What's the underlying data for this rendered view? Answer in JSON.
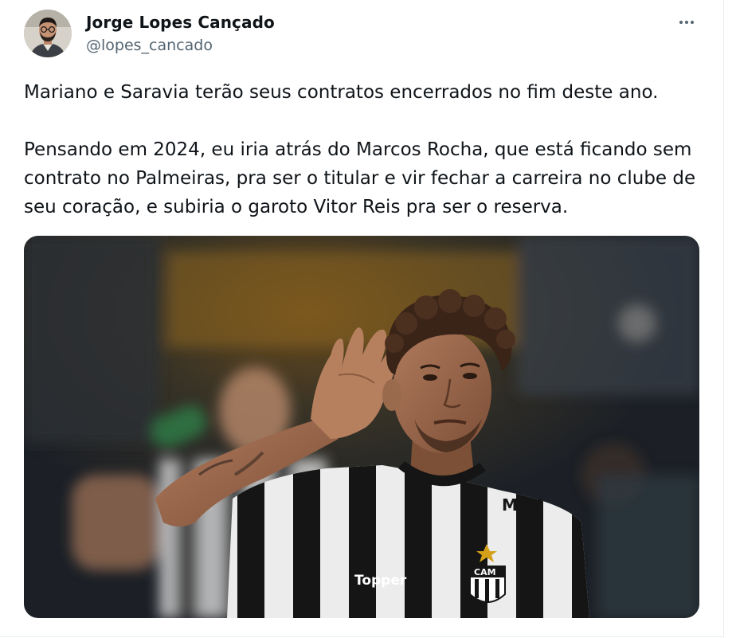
{
  "tweet": {
    "author": {
      "name": "Jorge Lopes Cançado",
      "handle": "@lopes_cancado"
    },
    "text": {
      "line1": "Mariano e Saravia terão seus contratos encerrados no fim deste ano.",
      "line2": "Pensando em 2024, eu iria atrás do Marcos Rocha, que está ficando sem",
      "line3": "contrato no Palmeiras, pra ser o titular e vir fechar a carreira no clube de",
      "line4": "seu coração, e subiria o garoto Vitor Reis pra ser o reserva."
    },
    "media": {
      "jersey_sponsor": "MRV",
      "jersey_brand": "Topper",
      "club_crest": "CAM"
    },
    "icons": {
      "more": "more-horizontal-icon"
    }
  }
}
